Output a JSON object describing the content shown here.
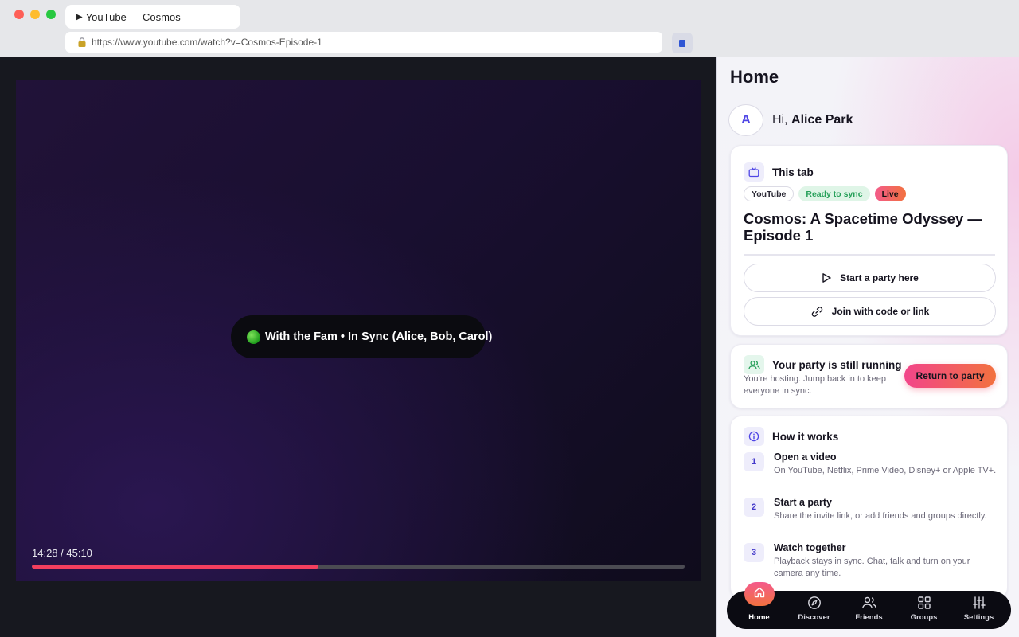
{
  "browser": {
    "tab_title": "YouTube — Cosmos",
    "url": "https://www.youtube.com/watch?v=Cosmos-Episode-1"
  },
  "player": {
    "sync_status": "With the Fam • In Sync (Alice, Bob, Carol)",
    "time": "14:28 / 45:10",
    "progress_fraction": 0.439
  },
  "sidebar": {
    "title": "Home",
    "avatar_initial": "A",
    "greeting_prefix": "Hi,",
    "user_name": "Alice Park",
    "this_tab": {
      "heading": "This tab",
      "chips": [
        "YouTube",
        "Ready to sync",
        "Live"
      ],
      "video_title": "Cosmos: A Spacetime Odyssey — Episode 1",
      "start_button": "Start a party here",
      "join_button": "Join with code or link"
    },
    "party": {
      "heading": "Your party is still running",
      "subtext": "You're hosting. Jump back in to keep everyone in sync.",
      "return_button": "Return to party"
    },
    "how_it_works": {
      "heading": "How it works",
      "steps": [
        {
          "num": "1",
          "title": "Open a video",
          "desc": "On YouTube, Netflix, Prime Video, Disney+ or Apple TV+."
        },
        {
          "num": "2",
          "title": "Start a party",
          "desc": "Share the invite link, or add friends and groups directly."
        },
        {
          "num": "3",
          "title": "Watch together",
          "desc": "Playback stays in sync. Chat, talk and turn on your camera any time."
        }
      ]
    },
    "nav": [
      "Home",
      "Discover",
      "Friends",
      "Groups",
      "Settings"
    ],
    "colors": {
      "accent": "#f2458a",
      "accent2": "#f2713f",
      "progress": "#f43f5e"
    }
  }
}
